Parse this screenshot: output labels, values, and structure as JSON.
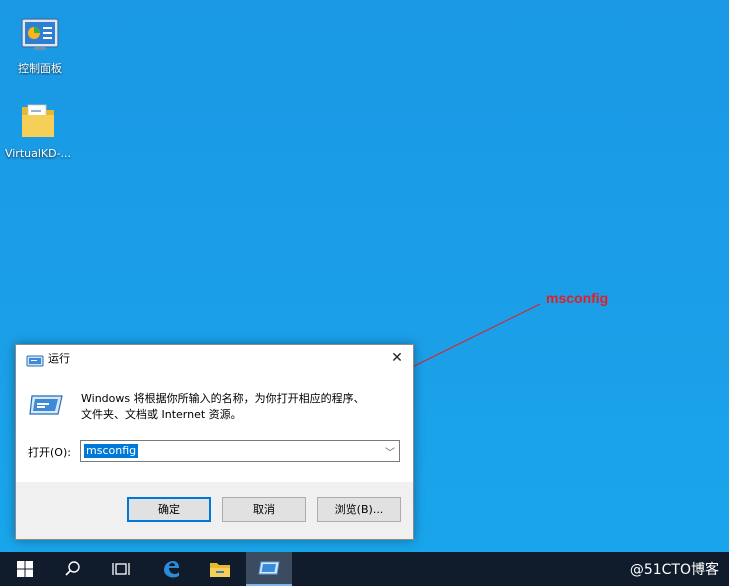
{
  "desktop": {
    "icons": [
      {
        "label": "控制面板",
        "icon": "control-panel-icon"
      },
      {
        "label": "VirtualKD-...",
        "icon": "folder-icon"
      }
    ]
  },
  "annotation": {
    "text": "msconfig",
    "color": "#e01e25"
  },
  "run_dialog": {
    "title": "运行",
    "close_glyph": "✕",
    "description_line1": "Windows 将根据你所输入的名称，为你打开相应的程序、",
    "description_line2": "文件夹、文档或 Internet 资源。",
    "open_label": "打开(O):",
    "input_value": "msconfig",
    "ok_label": "确定",
    "cancel_label": "取消",
    "browse_label": "浏览(B)..."
  },
  "taskbar": {
    "items": [
      "start-icon",
      "search-icon",
      "task-view-icon",
      "edge-icon",
      "file-explorer-icon",
      "run-icon"
    ],
    "watermark": "@51CTO博客"
  },
  "colors": {
    "accent": "#0078d7",
    "desktop": "#1a9ee6",
    "taskbar": "#101c2b"
  }
}
